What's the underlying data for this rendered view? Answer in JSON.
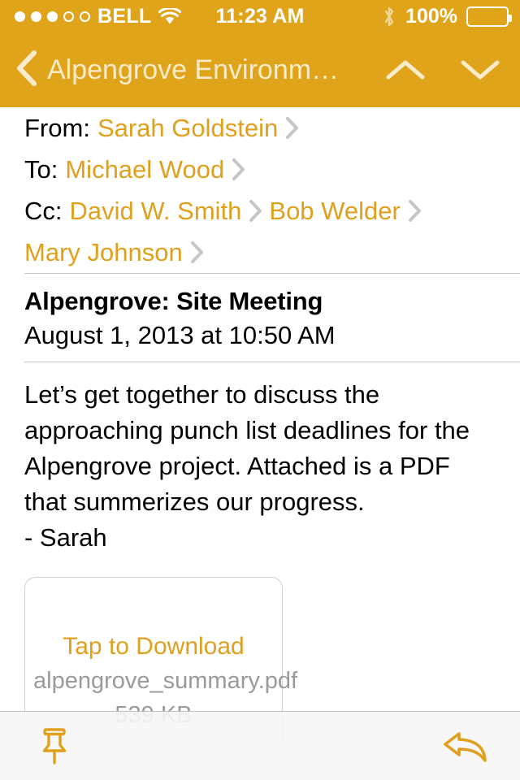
{
  "status_bar": {
    "signal_dots_filled": 3,
    "signal_dots_total": 5,
    "carrier": "BELL",
    "wifi_icon": "wifi-icon",
    "time": "11:23 AM",
    "bluetooth_icon": "bluetooth-icon",
    "battery_percent": "100%",
    "battery_icon": "battery-full-icon"
  },
  "navbar": {
    "back_icon": "chevron-left-icon",
    "title": "Alpengrove Environm…",
    "prev_message_icon": "chevron-up-icon",
    "next_message_icon": "chevron-down-icon"
  },
  "header": {
    "from_label": "From:",
    "from_name": "Sarah Goldstein",
    "to_label": "To:",
    "to_name": "Michael Wood",
    "cc_label": "Cc:",
    "cc_names": [
      "David W. Smith",
      "Bob Welder",
      "Mary Johnson"
    ],
    "disclosure_icon": "chevron-right-icon"
  },
  "message": {
    "subject": "Alpengrove: Site Meeting",
    "datetime": "August 1, 2013 at 10:50 AM",
    "body": "Let’s get together to discuss the approaching punch list deadlines for the Alpengrove project. Attached is a PDF that summerizes our progress.\n- Sarah"
  },
  "attachment": {
    "tap_label": "Tap to Download",
    "filename": "alpengrove_summary.pdf",
    "filesize": "539 KB"
  },
  "toolbar": {
    "flag_icon": "pushpin-icon",
    "reply_icon": "reply-arrow-icon"
  },
  "colors": {
    "accent": "#DFA01D",
    "bar_background": "#E0A41B",
    "nav_title": "#FAEBCB",
    "separator": "#C8C8C8",
    "toolbar_background": "#F6F6F6",
    "muted_text": "#9A9A9A"
  }
}
